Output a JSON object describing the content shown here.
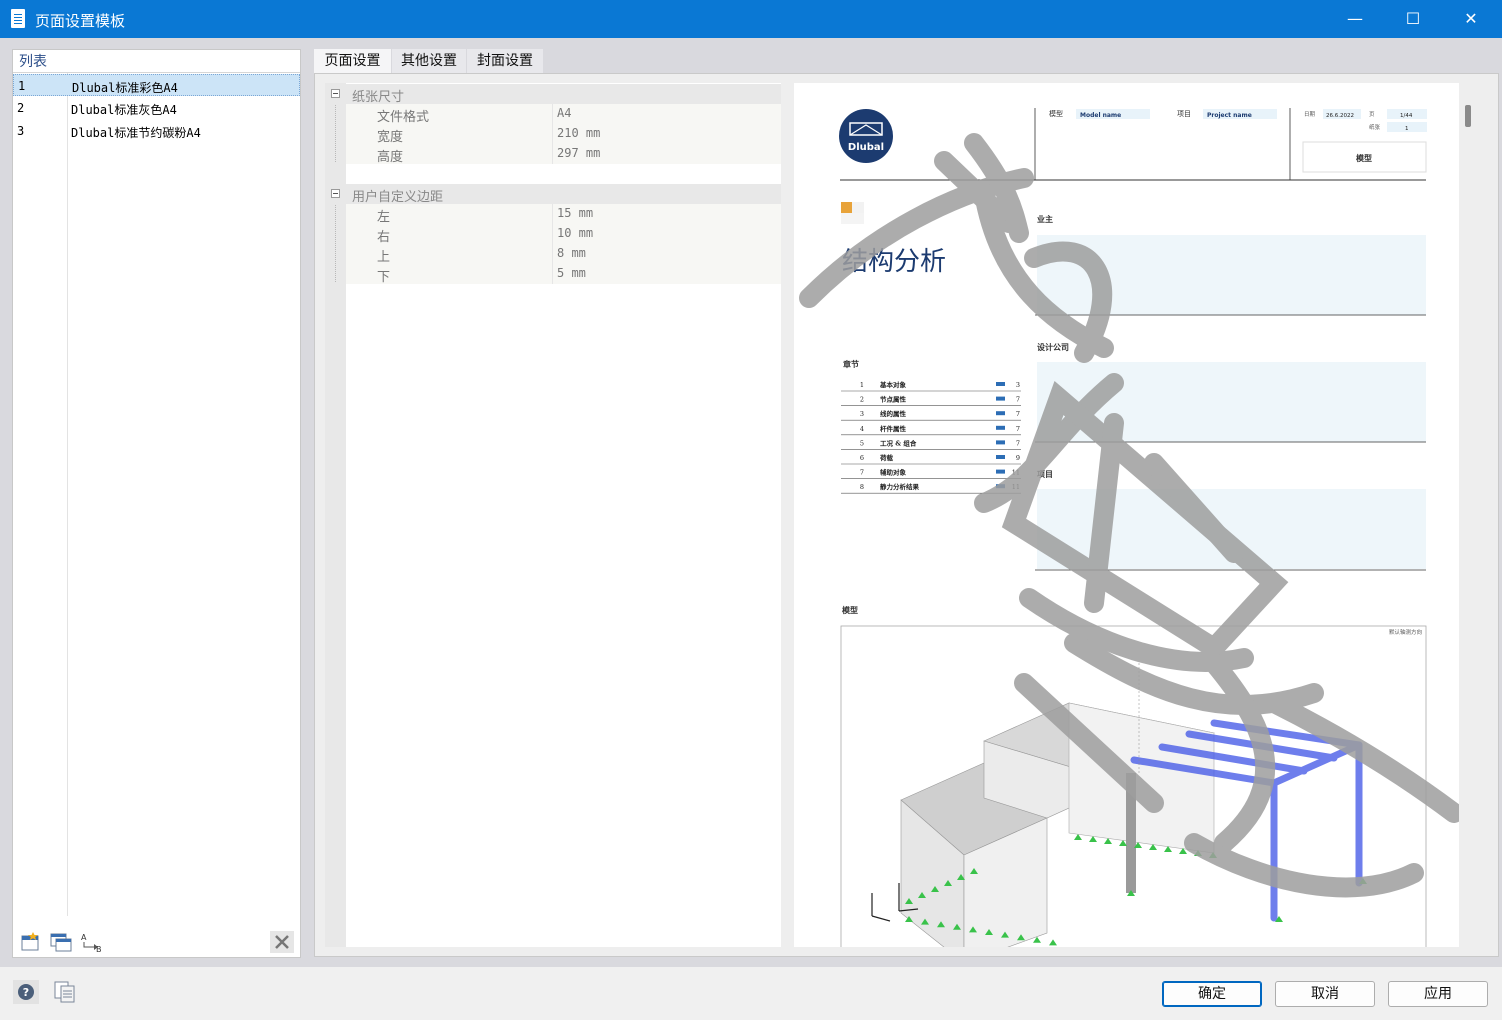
{
  "window": {
    "title": "页面设置模板",
    "minimize_glyph": "—",
    "maximize_glyph": "☐",
    "close_glyph": "✕"
  },
  "list": {
    "header": "列表",
    "items": [
      {
        "num": "1",
        "name": "Dlubal标准彩色A4"
      },
      {
        "num": "2",
        "name": "Dlubal标准灰色A4"
      },
      {
        "num": "3",
        "name": "Dlubal标准节约碳粉A4"
      }
    ],
    "tools": [
      "new-icon",
      "copy-icon",
      "rename-icon",
      "delete-icon"
    ]
  },
  "tabs": [
    "页面设置",
    "其他设置",
    "封面设置"
  ],
  "grid": {
    "paper": {
      "title": "纸张尺寸",
      "rows": [
        {
          "label": "文件格式",
          "value": "A4"
        },
        {
          "label": "宽度",
          "value": "210 mm"
        },
        {
          "label": "高度",
          "value": "297 mm"
        }
      ]
    },
    "margins": {
      "title": "用户自定义边距",
      "rows": [
        {
          "label": "左",
          "value": "15 mm"
        },
        {
          "label": "右",
          "value": "10 mm"
        },
        {
          "label": "上",
          "value": "8 mm"
        },
        {
          "label": "下",
          "value": "5 mm"
        }
      ]
    }
  },
  "preview": {
    "logo_text": "Dlubal",
    "model_label": "模型",
    "model_value": "Model name",
    "project_label": "项目",
    "project_value": "Project name",
    "date_label": "日期",
    "date_value": "26.6.2022",
    "page_label": "页",
    "page_value": "1/44",
    "sheet_label": "纸张",
    "sheet_value": "1",
    "model_box": "模型",
    "main_title": "结构分析",
    "owner_label": "业主",
    "design_label": "设计公司",
    "project2_label": "项目",
    "chapters_label": "章节",
    "chapters": [
      {
        "n": "1",
        "name": "基本对象",
        "page": "3"
      },
      {
        "n": "2",
        "name": "节点属性",
        "page": "7"
      },
      {
        "n": "3",
        "name": "线的属性",
        "page": "7"
      },
      {
        "n": "4",
        "name": "杆件属性",
        "page": "7"
      },
      {
        "n": "5",
        "name": "工况 & 组合",
        "page": "7"
      },
      {
        "n": "6",
        "name": "荷载",
        "page": "9"
      },
      {
        "n": "7",
        "name": "辅助对象",
        "page": "11"
      },
      {
        "n": "8",
        "name": "静力分析结果",
        "page": "11"
      }
    ],
    "model_section_label": "模型",
    "view_label": "默认轴测方向",
    "accent_color": "#e8a33a",
    "title_color": "#1c3b70"
  },
  "buttons": {
    "ok": "确定",
    "cancel": "取消",
    "apply": "应用"
  },
  "footer_icons": [
    "help-icon",
    "library-icon"
  ]
}
